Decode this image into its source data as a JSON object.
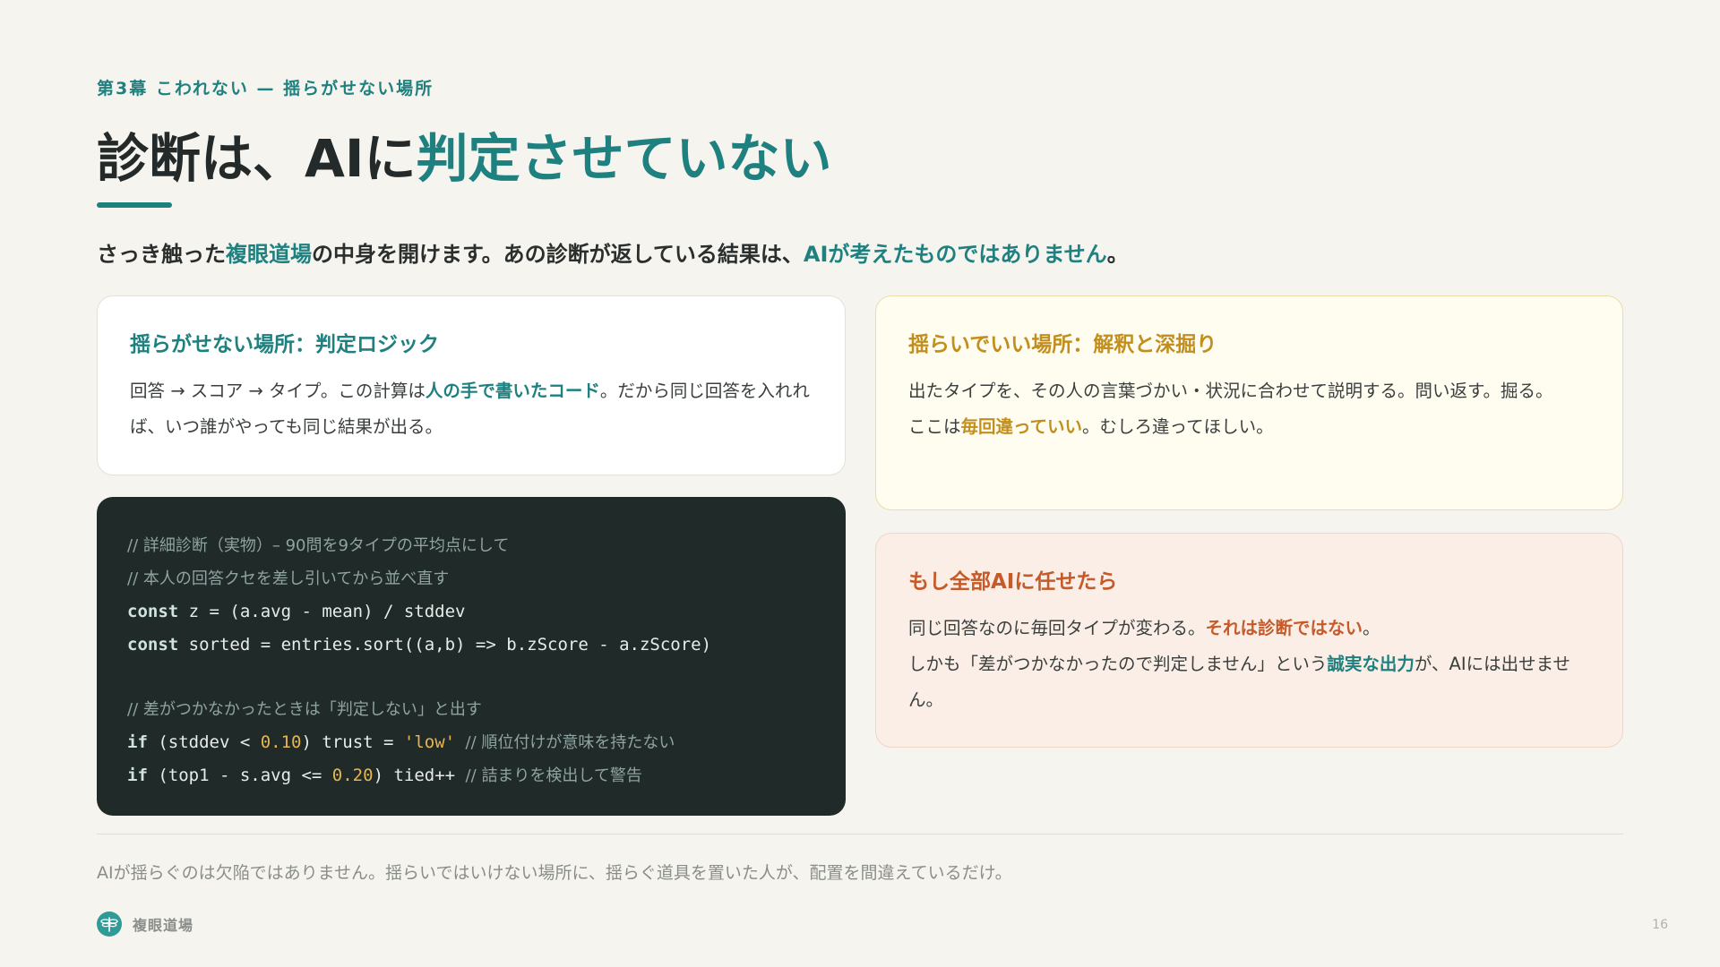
{
  "header": {
    "eyebrow": "第3幕 こわれない — 揺らがせない場所",
    "title_main": "診断は、AIに",
    "title_highlight": "判定させていない"
  },
  "lead": {
    "part1": "さっき触った",
    "hl1": "複眼道場",
    "part2": "の中身を開けます。あの診断が返している結果は、",
    "hl2": "AIが考えたものではありません",
    "part3": "。"
  },
  "card_logic": {
    "title": "揺らがせない場所：判定ロジック",
    "text1": "回答 → スコア → タイプ。この計算は",
    "em": "人の手で書いたコード",
    "text2": "。だから同じ回答を入れれば、いつ誰がやっても同じ結果が出る。"
  },
  "code": {
    "l1": "// 詳細診断（実物）– 90問を9タイプの平均点にして",
    "l2": "// 本人の回答クセを差し引いてから並べ直す",
    "l3_kw": "const",
    "l3_rest": " z = (a.avg - mean) / stddev",
    "l4_kw": "const",
    "l4_rest": " sorted = entries.sort((a,b) => b.zScore - a.zScore)",
    "l5": "// 差がつかなかったときは「判定しない」と出す",
    "l6_kw": "if",
    "l6_a": " (stddev < ",
    "l6_num": "0.10",
    "l6_b": ") trust = ",
    "l6_str": "'low'",
    "l6_cm": "  // 順位付けが意味を持たない",
    "l7_kw": "if",
    "l7_a": " (top1 - s.avg <= ",
    "l7_num": "0.20",
    "l7_b": ") tied++ ",
    "l7_cm": "// 詰まりを検出して警告"
  },
  "card_interp": {
    "title": "揺らいでいい場所：解釈と深掘り",
    "text1": "出たタイプを、その人の言葉づかい・状況に合わせて説明する。問い返す。掘る。",
    "text2a": "ここは",
    "em": "毎回違っていい",
    "text2b": "。むしろ違ってほしい。"
  },
  "card_risk": {
    "title": "もし全部AIに任せたら",
    "text1a": "同じ回答なのに毎回タイプが変わる。",
    "em_warn": "それは診断ではない",
    "text1b": "。",
    "text2a": "しかも「差がつかなかったので判定しません」という",
    "em": "誠実な出力",
    "text2b": "が、AIには出せません。"
  },
  "footer": {
    "note": "AIが揺らぐのは欠陥ではありません。揺らいではいけない場所に、揺らぐ道具を置いた人が、配置を間違えているだけ。",
    "brand": "複眼道場",
    "page": "16"
  },
  "colors": {
    "accent": "#1f8080",
    "amber": "#c28f1e",
    "warn": "#c55a2a",
    "code_bg": "#1f2a29"
  },
  "icons": {
    "brand_logo": "dragonfly-icon"
  }
}
